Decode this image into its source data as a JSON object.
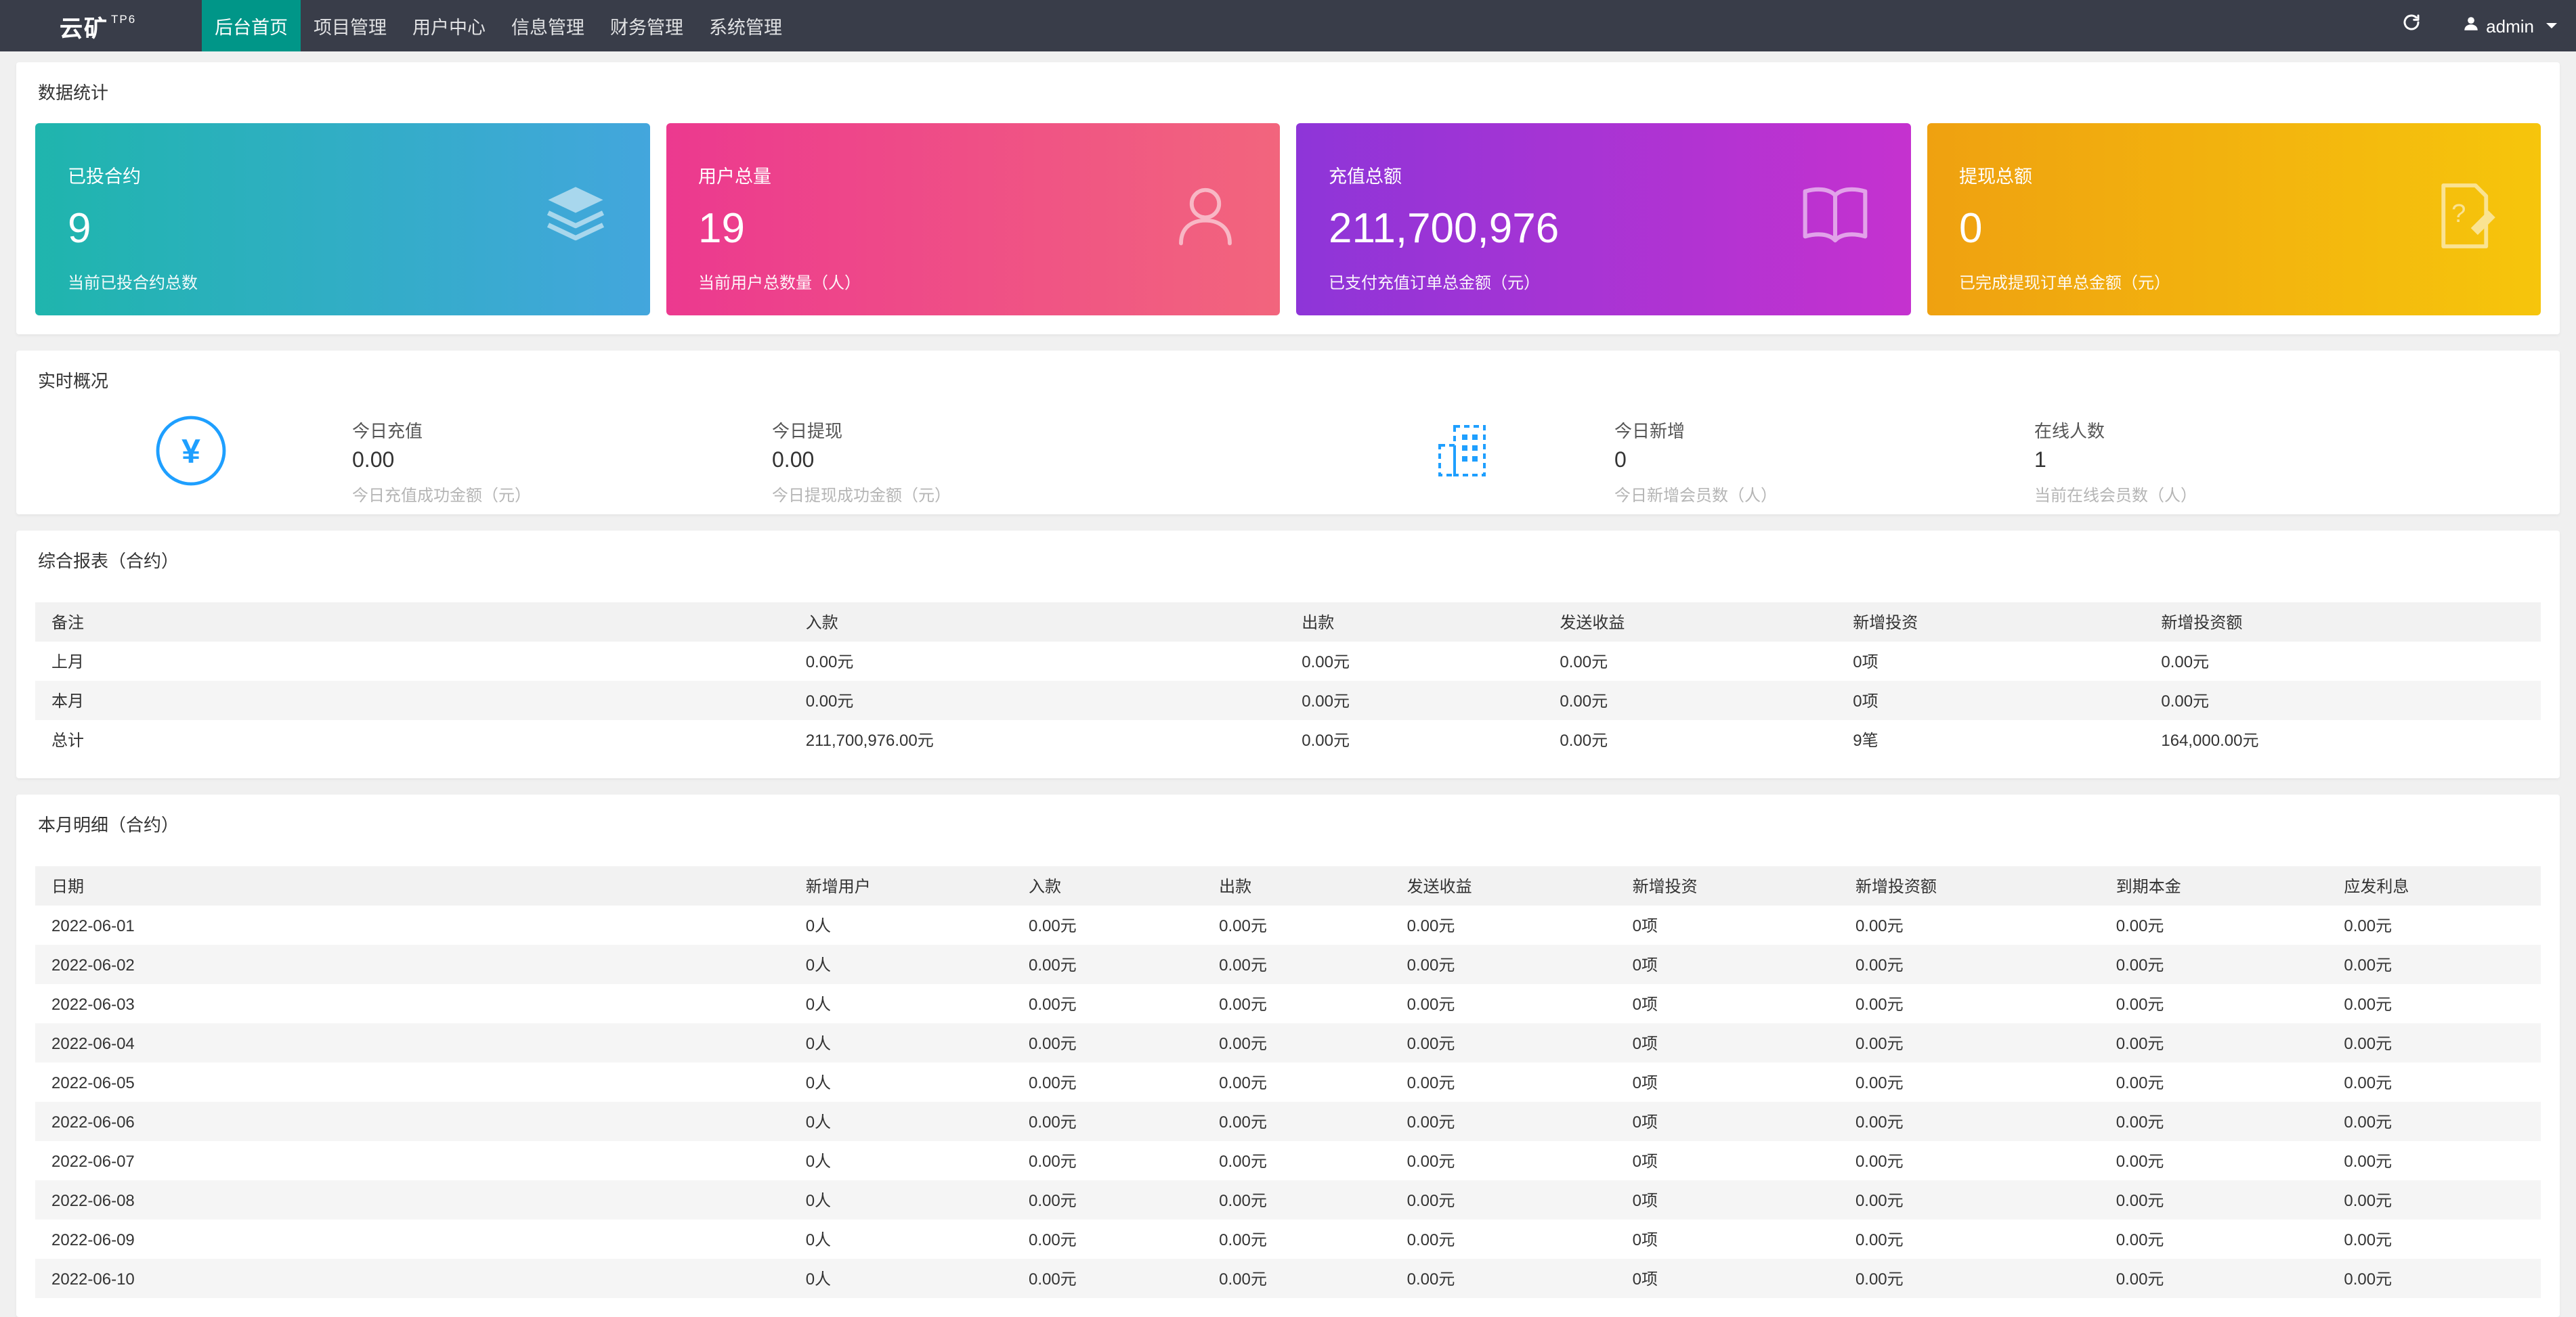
{
  "colors": {
    "navbar_bg": "#393D49",
    "nav_active_bg": "#009688",
    "icon_accent_blue": "#1E9FFF"
  },
  "navbar": {
    "logo": "云矿",
    "logo_sup": "TP6",
    "items": [
      {
        "label": "后台首页",
        "active": true
      },
      {
        "label": "项目管理",
        "active": false
      },
      {
        "label": "用户中心",
        "active": false
      },
      {
        "label": "信息管理",
        "active": false
      },
      {
        "label": "财务管理",
        "active": false
      },
      {
        "label": "系统管理",
        "active": false
      }
    ],
    "username": "admin"
  },
  "stats": {
    "title": "数据统计",
    "cards": [
      {
        "label": "已投合约",
        "value": "9",
        "caption": "当前已投合约总数",
        "icon": "layers-icon",
        "gradient": [
          "#1fb5ad",
          "#43a6dd"
        ]
      },
      {
        "label": "用户总量",
        "value": "19",
        "caption": "当前用户总数量（人）",
        "icon": "user-icon",
        "gradient": [
          "#ec398f",
          "#f2657d"
        ]
      },
      {
        "label": "充值总额",
        "value": "211,700,976",
        "caption": "已支付充值订单总金额（元）",
        "icon": "book-icon",
        "gradient": [
          "#8e35d8",
          "#c532cf"
        ]
      },
      {
        "label": "提现总额",
        "value": "0",
        "caption": "已完成提现订单总金额（元）",
        "icon": "document-question-icon",
        "gradient": [
          "#efa110",
          "#f6c50c"
        ]
      }
    ]
  },
  "realtime": {
    "title": "实时概况",
    "stats": [
      {
        "label": "今日充值",
        "value": "0.00",
        "caption": "今日充值成功金额（元）"
      },
      {
        "label": "今日提现",
        "value": "0.00",
        "caption": "今日提现成功金额（元）"
      },
      {
        "label": "今日新增",
        "value": "0",
        "caption": "今日新增会员数（人）"
      },
      {
        "label": "在线人数",
        "value": "1",
        "caption": "当前在线会员数（人）"
      }
    ]
  },
  "report": {
    "title": "综合报表（合约）",
    "headers": [
      "备注",
      "入款",
      "出款",
      "发送收益",
      "新增投资",
      "新增投资额"
    ],
    "rows": [
      [
        "上月",
        "0.00元",
        "0.00元",
        "0.00元",
        "0项",
        "0.00元"
      ],
      [
        "本月",
        "0.00元",
        "0.00元",
        "0.00元",
        "0项",
        "0.00元"
      ],
      [
        "总计",
        "211,700,976.00元",
        "0.00元",
        "0.00元",
        "9笔",
        "164,000.00元"
      ]
    ]
  },
  "detail": {
    "title": "本月明细（合约）",
    "headers": [
      "日期",
      "新增用户",
      "入款",
      "出款",
      "发送收益",
      "新增投资",
      "新增投资额",
      "到期本金",
      "应发利息"
    ],
    "rows": [
      [
        "2022-06-01",
        "0人",
        "0.00元",
        "0.00元",
        "0.00元",
        "0项",
        "0.00元",
        "0.00元",
        "0.00元"
      ],
      [
        "2022-06-02",
        "0人",
        "0.00元",
        "0.00元",
        "0.00元",
        "0项",
        "0.00元",
        "0.00元",
        "0.00元"
      ],
      [
        "2022-06-03",
        "0人",
        "0.00元",
        "0.00元",
        "0.00元",
        "0项",
        "0.00元",
        "0.00元",
        "0.00元"
      ],
      [
        "2022-06-04",
        "0人",
        "0.00元",
        "0.00元",
        "0.00元",
        "0项",
        "0.00元",
        "0.00元",
        "0.00元"
      ],
      [
        "2022-06-05",
        "0人",
        "0.00元",
        "0.00元",
        "0.00元",
        "0项",
        "0.00元",
        "0.00元",
        "0.00元"
      ],
      [
        "2022-06-06",
        "0人",
        "0.00元",
        "0.00元",
        "0.00元",
        "0项",
        "0.00元",
        "0.00元",
        "0.00元"
      ],
      [
        "2022-06-07",
        "0人",
        "0.00元",
        "0.00元",
        "0.00元",
        "0项",
        "0.00元",
        "0.00元",
        "0.00元"
      ],
      [
        "2022-06-08",
        "0人",
        "0.00元",
        "0.00元",
        "0.00元",
        "0项",
        "0.00元",
        "0.00元",
        "0.00元"
      ],
      [
        "2022-06-09",
        "0人",
        "0.00元",
        "0.00元",
        "0.00元",
        "0项",
        "0.00元",
        "0.00元",
        "0.00元"
      ],
      [
        "2022-06-10",
        "0人",
        "0.00元",
        "0.00元",
        "0.00元",
        "0项",
        "0.00元",
        "0.00元",
        "0.00元"
      ]
    ]
  }
}
